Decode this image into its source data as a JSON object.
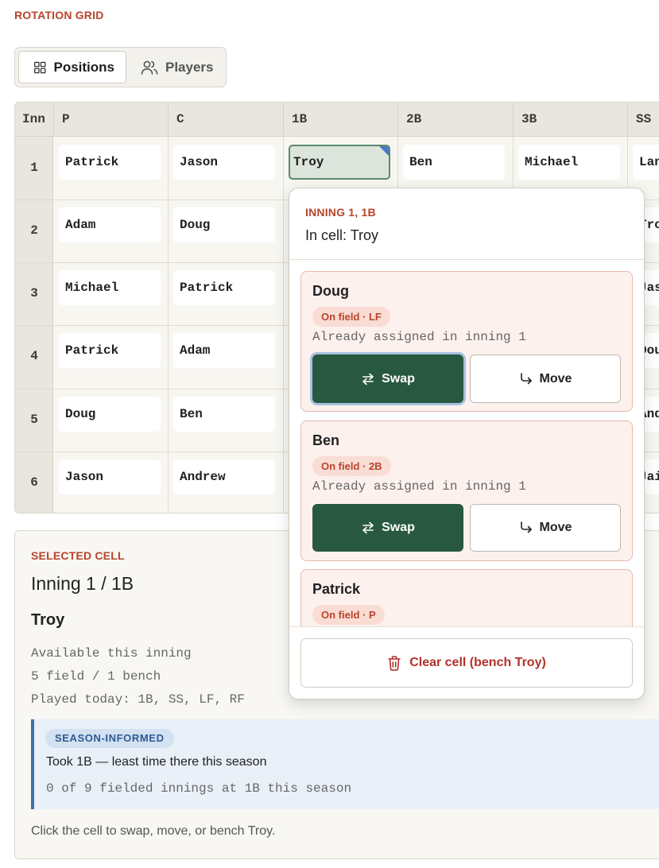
{
  "section_title": "ROTATION GRID",
  "view_toggle": {
    "positions_label": "Positions",
    "players_label": "Players",
    "active": "Positions"
  },
  "grid": {
    "columns": [
      "Inn",
      "P",
      "C",
      "1B",
      "2B",
      "3B",
      "SS"
    ],
    "innings": [
      "1",
      "2",
      "3",
      "4",
      "5",
      "6"
    ],
    "rows": [
      [
        "Patrick",
        "Jason",
        "Troy",
        "Ben",
        "Michael",
        "Lan"
      ],
      [
        "Adam",
        "Doug",
        "",
        "",
        "",
        "Tro"
      ],
      [
        "Michael",
        "Patrick",
        "",
        "",
        "",
        "Jas"
      ],
      [
        "Patrick",
        "Adam",
        "",
        "",
        "",
        "Dou"
      ],
      [
        "Doug",
        "Ben",
        "",
        "",
        "",
        "And"
      ],
      [
        "Jason",
        "Andrew",
        "",
        "",
        "",
        "Jai"
      ]
    ],
    "selected": "Troy"
  },
  "popover": {
    "label": "INNING 1, 1B",
    "subtitle": "In cell: Troy",
    "candidates": [
      {
        "name": "Doug",
        "badge": "On field · LF",
        "note": "Already assigned in inning 1",
        "swap": "Swap",
        "move": "Move"
      },
      {
        "name": "Ben",
        "badge": "On field · 2B",
        "note": "Already assigned in inning 1",
        "swap": "Swap",
        "move": "Move"
      },
      {
        "name": "Patrick",
        "badge": "On field · P"
      }
    ],
    "clear_label": "Clear cell (bench Troy)"
  },
  "selected_cell": {
    "label": "SELECTED CELL",
    "title": "Inning 1 / 1B",
    "player": "Troy",
    "availability": "Available this inning",
    "split": "5 field / 1 bench",
    "played_today": "Played today: 1B, SS, LF, RF",
    "season": {
      "badge": "SEASON-INFORMED",
      "text": "Took 1B — least time there this season",
      "stat": "0 of 9 fielded innings at 1B this season"
    },
    "footer": "Click the cell to swap, move, or bench Troy."
  },
  "colors": {
    "accent": "#b8442c",
    "primary": "#285940",
    "info": "#3f6fb0",
    "danger": "#b0322a"
  }
}
